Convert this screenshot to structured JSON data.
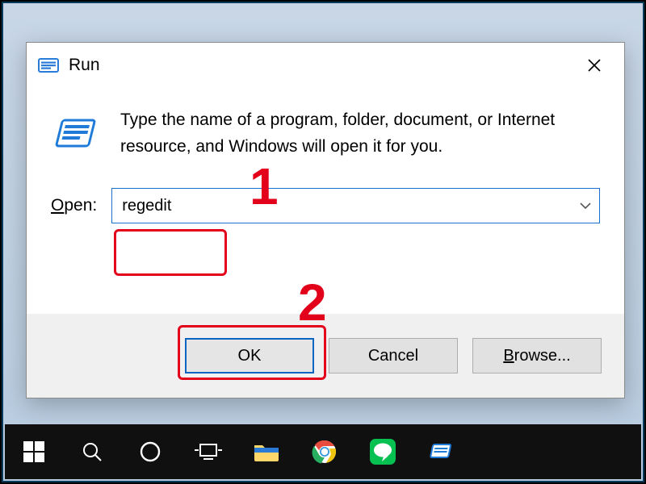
{
  "window": {
    "title": "Run",
    "description": "Type the name of a program, folder, document, or Internet resource, and Windows will open it for you.",
    "open_label_prefix": "O",
    "open_label_rest": "pen:",
    "input_value": "regedit",
    "buttons": {
      "ok": "OK",
      "cancel": "Cancel",
      "browse_prefix": "B",
      "browse_rest": "rowse..."
    }
  },
  "annotations": {
    "step1": "1",
    "step2": "2"
  },
  "taskbar": {
    "items": [
      "start",
      "search",
      "cortana",
      "task-view",
      "file-explorer",
      "chrome",
      "line",
      "run"
    ]
  }
}
